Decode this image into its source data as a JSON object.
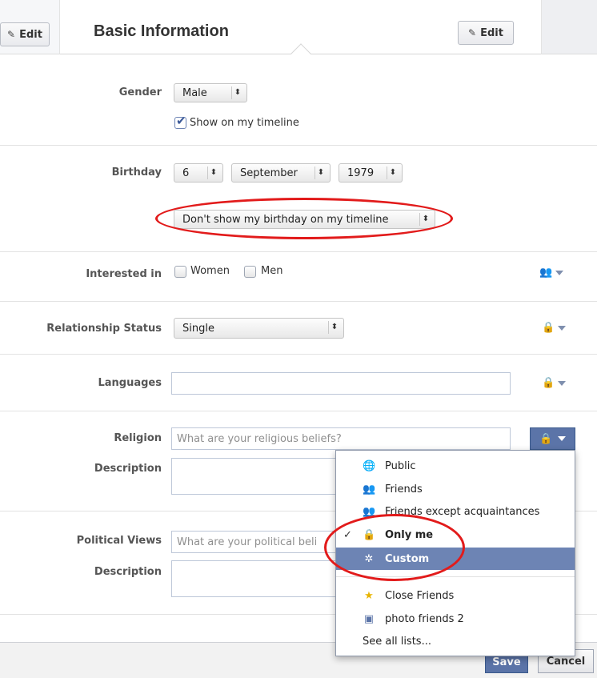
{
  "header": {
    "left_edit_label": "Edit",
    "title": "Basic Information",
    "edit_label": "Edit"
  },
  "gender": {
    "label": "Gender",
    "value": "Male",
    "show_on_timeline": "Show on my timeline",
    "show_on_timeline_checked": true
  },
  "birthday": {
    "label": "Birthday",
    "day": "6",
    "month": "September",
    "year": "1979",
    "visibility": "Don't show my birthday on my timeline"
  },
  "interested_in": {
    "label": "Interested in",
    "options": [
      "Women",
      "Men"
    ],
    "privacy_icon": "friends-icon"
  },
  "relationship": {
    "label": "Relationship Status",
    "value": "Single",
    "privacy_icon": "lock-icon"
  },
  "languages": {
    "label": "Languages",
    "value": "",
    "privacy_icon": "lock-icon"
  },
  "religion": {
    "label": "Religion",
    "placeholder": "What are your religious beliefs?",
    "description_label": "Description",
    "privacy_icon": "lock-icon"
  },
  "political": {
    "label": "Political Views",
    "placeholder": "What are your political beliefs?",
    "visible_placeholder": "What are your political beli",
    "description_label": "Description"
  },
  "privacy_menu": {
    "items": [
      {
        "label": "Public",
        "icon": "globe-icon"
      },
      {
        "label": "Friends",
        "icon": "friends-icon"
      },
      {
        "label": "Friends except acquaintances",
        "icon": "friends-except-icon"
      },
      {
        "label": "Only me",
        "icon": "lock-icon",
        "checked": true
      },
      {
        "label": "Custom",
        "icon": "gear-icon",
        "highlighted": true
      },
      {
        "label": "Close Friends",
        "icon": "star-icon"
      },
      {
        "label": "photo friends 2",
        "icon": "list-icon"
      }
    ],
    "see_all": "See all lists..."
  },
  "footer": {
    "save_label": "Save",
    "cancel_label": "Cancel"
  },
  "colors": {
    "facebook_blue": "#5b74a8",
    "menu_highlight": "#6d84b4",
    "annotation_red": "#e21b1b"
  }
}
